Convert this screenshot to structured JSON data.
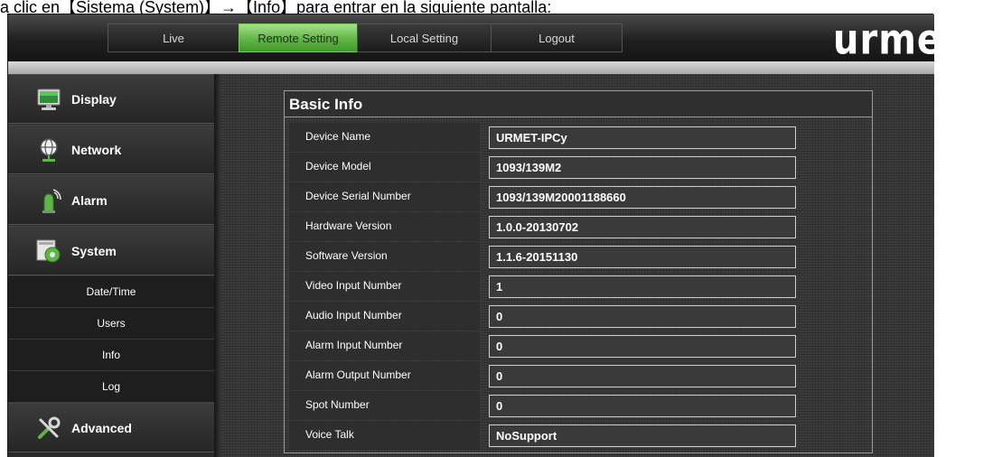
{
  "caption": "a clic en【Sistema (System)】→【Info】para entrar en la siguiente pantalla:",
  "topbar": {
    "tabs": [
      {
        "label": "Live"
      },
      {
        "label": "Remote Setting"
      },
      {
        "label": "Local Setting"
      },
      {
        "label": "Logout"
      }
    ],
    "active_tab": "Remote Setting",
    "logo": "urmet"
  },
  "sidebar": {
    "items": [
      {
        "label": "Display",
        "icon": "monitor-icon"
      },
      {
        "label": "Network",
        "icon": "network-globe-icon"
      },
      {
        "label": "Alarm",
        "icon": "alarm-siren-icon"
      },
      {
        "label": "System",
        "icon": "system-gear-icon"
      }
    ],
    "system_subitems": [
      {
        "label": "Date/Time"
      },
      {
        "label": "Users"
      },
      {
        "label": "Info"
      },
      {
        "label": "Log"
      }
    ],
    "advanced": {
      "label": "Advanced",
      "icon": "tools-icon"
    },
    "active_subitem": "Info"
  },
  "panel": {
    "title": "Basic Info",
    "rows": [
      {
        "label": "Device Name",
        "value": "URMET-IPCy"
      },
      {
        "label": "Device Model",
        "value": "1093/139M2"
      },
      {
        "label": "Device Serial Number",
        "value": "1093/139M20001188660"
      },
      {
        "label": "Hardware Version",
        "value": "1.0.0-20130702"
      },
      {
        "label": "Software Version",
        "value": "1.1.6-20151130"
      },
      {
        "label": "Video Input Number",
        "value": "1"
      },
      {
        "label": "Audio Input Number",
        "value": "0"
      },
      {
        "label": "Alarm Input Number",
        "value": "0"
      },
      {
        "label": "Alarm Output Number",
        "value": "0"
      },
      {
        "label": "Spot Number",
        "value": "0"
      },
      {
        "label": "Voice Talk",
        "value": "NoSupport"
      }
    ]
  },
  "colors": {
    "active_tab": "#5fb545",
    "background": "#2b2b2b",
    "panel_border": "#9a9a9a"
  }
}
